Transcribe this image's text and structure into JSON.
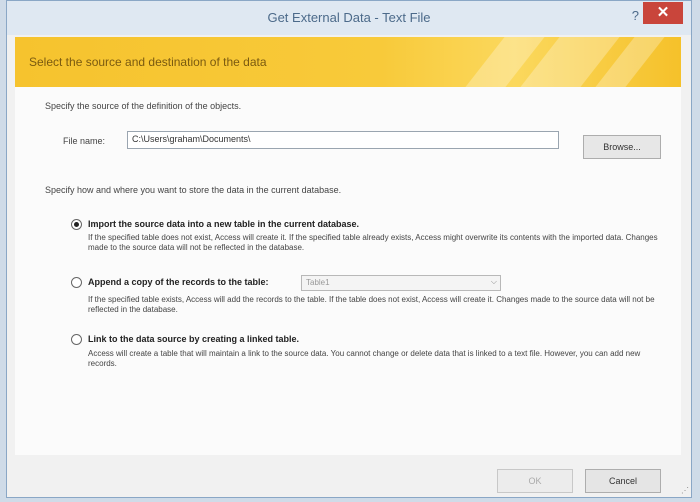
{
  "window": {
    "title": "Get External Data - Text File",
    "help_label": "?",
    "close_label": "✕"
  },
  "banner": {
    "text": "Select the source and destination of the data"
  },
  "source": {
    "instruction": "Specify the source of the definition of the objects.",
    "file_name_label": "File name:",
    "file_name_value": "C:\\Users\\graham\\Documents\\",
    "browse_label": "Browse..."
  },
  "destination": {
    "instruction": "Specify how and where you want to store the data in the current database.",
    "options": [
      {
        "label": "Import the source data into a new table in the current database.",
        "description": "If the specified table does not exist, Access will create it. If the specified table already exists, Access might overwrite its contents with the imported data. Changes made to the source data will not be reflected in the database.",
        "selected": true
      },
      {
        "label": "Append a copy of the records to the table:",
        "description": "If the specified table exists, Access will add the records to the table. If the table does not exist, Access will create it. Changes made to the source data will not be reflected in the database.",
        "selected": false,
        "table_value": "Table1"
      },
      {
        "label": "Link to the data source by creating a linked table.",
        "description": "Access will create a table that will maintain a link to the source data. You cannot change or delete data that is linked to a text file. However, you can add new records.",
        "selected": false
      }
    ]
  },
  "footer": {
    "ok_label": "OK",
    "cancel_label": "Cancel"
  }
}
